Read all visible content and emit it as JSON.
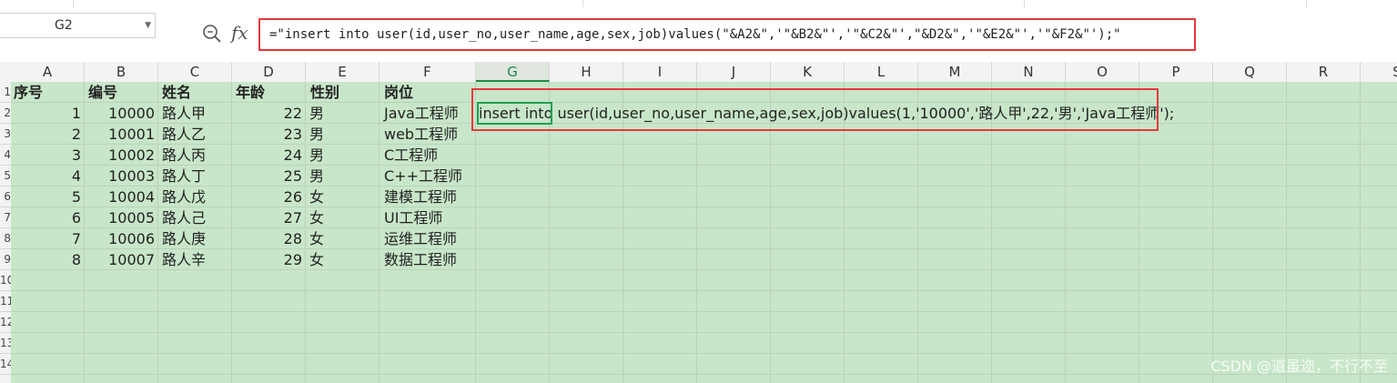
{
  "name_box": {
    "value": "G2"
  },
  "formula_bar": {
    "fx_label": "fx",
    "formula": "=\"insert into user(id,user_no,user_name,age,sex,job)values(\"&A2&\",'\"&B2&\"','\"&C2&\"',\"&D2&\",'\"&E2&\"','\"&F2&\"');\""
  },
  "columns": [
    "A",
    "B",
    "C",
    "D",
    "E",
    "F",
    "G",
    "H",
    "I",
    "J",
    "K",
    "L",
    "M",
    "N",
    "O",
    "P",
    "Q",
    "R",
    "S"
  ],
  "selected_column": "G",
  "row_numbers": [
    "1",
    "2",
    "3",
    "4",
    "5",
    "6",
    "7",
    "8",
    "9",
    "10",
    "11",
    "12",
    "13",
    "14"
  ],
  "headers": [
    "序号",
    "编号",
    "姓名",
    "年龄",
    "性别",
    "岗位"
  ],
  "rows": [
    [
      "1",
      "10000",
      "路人甲",
      "22",
      "男",
      "Java工程师"
    ],
    [
      "2",
      "10001",
      "路人乙",
      "23",
      "男",
      "web工程师"
    ],
    [
      "3",
      "10002",
      "路人丙",
      "24",
      "男",
      "C工程师"
    ],
    [
      "4",
      "10003",
      "路人丁",
      "25",
      "男",
      "C++工程师"
    ],
    [
      "5",
      "10004",
      "路人戊",
      "26",
      "女",
      "建模工程师"
    ],
    [
      "6",
      "10005",
      "路人己",
      "27",
      "女",
      "UI工程师"
    ],
    [
      "7",
      "10006",
      "路人庚",
      "28",
      "女",
      "运维工程师"
    ],
    [
      "8",
      "10007",
      "路人辛",
      "29",
      "女",
      "数据工程师"
    ]
  ],
  "result_cell": "insert into user(id,user_no,user_name,age,sex,job)values(1,'10000','路人甲',22,'男','Java工程师');",
  "watermark": "CSDN @道虽迩，不行不至",
  "colors": {
    "grid_bg": "#c8e6c9",
    "highlight": "#e5393d",
    "active": "#1e9f4e"
  }
}
